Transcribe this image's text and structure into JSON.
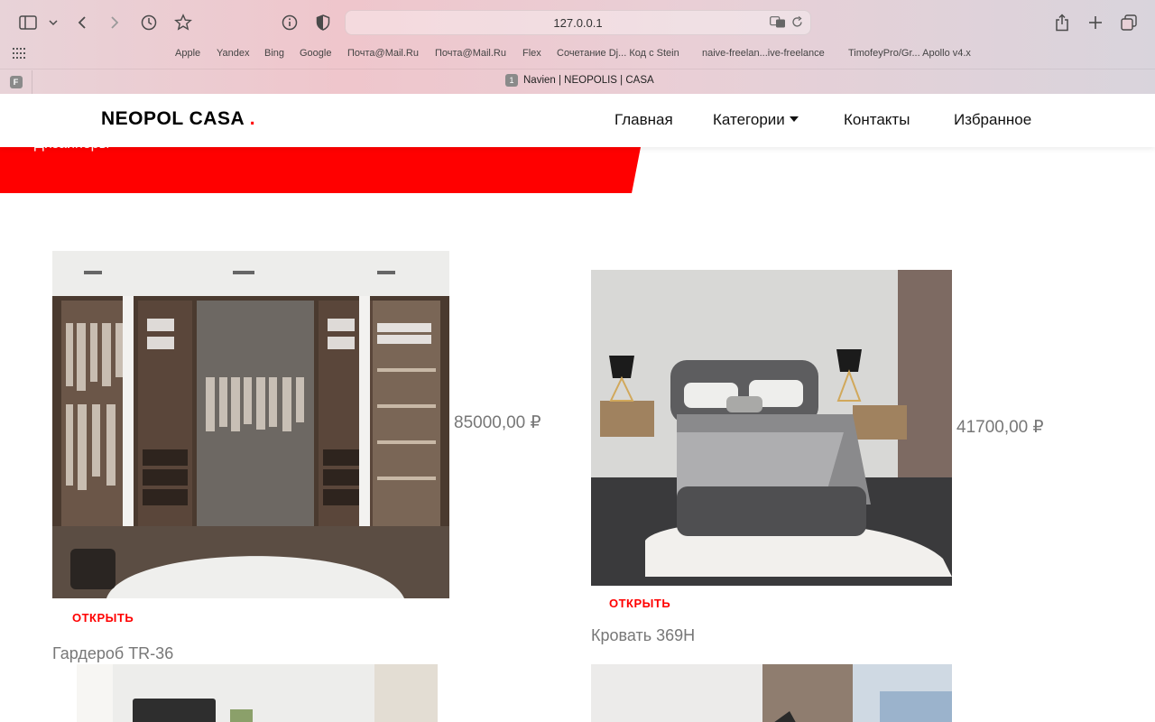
{
  "browser": {
    "url": "127.0.0.1",
    "bookmarks": [
      "Apple",
      "Yandex",
      "Bing",
      "Google",
      "Почта@Mail.Ru",
      "Почта@Mail.Ru",
      "Flex",
      "Сочетание Dj... Код с Stein",
      "naive-freelan...ive-freelance",
      "TimofeyPro/Gr... Apollo v4.x"
    ],
    "tab_badge": "F",
    "tab_number": "1",
    "tab_title": "Navien | NEOPOLIS | CASA"
  },
  "nav": {
    "brand": "NEOPOL CASA",
    "brand_dot": ".",
    "links": [
      "Главная",
      "Категории",
      "Контакты",
      "Избранное"
    ]
  },
  "hero": {
    "text": "Дизайнеры"
  },
  "products": [
    {
      "name": "Гардероб TR-36",
      "price": "85000,00 ₽",
      "open_label": "ОТКРЫТЬ"
    },
    {
      "name": "Кровать 369H",
      "price": "41700,00 ₽",
      "open_label": "ОТКРЫТЬ"
    }
  ],
  "colors": {
    "accent": "#ff0000"
  }
}
